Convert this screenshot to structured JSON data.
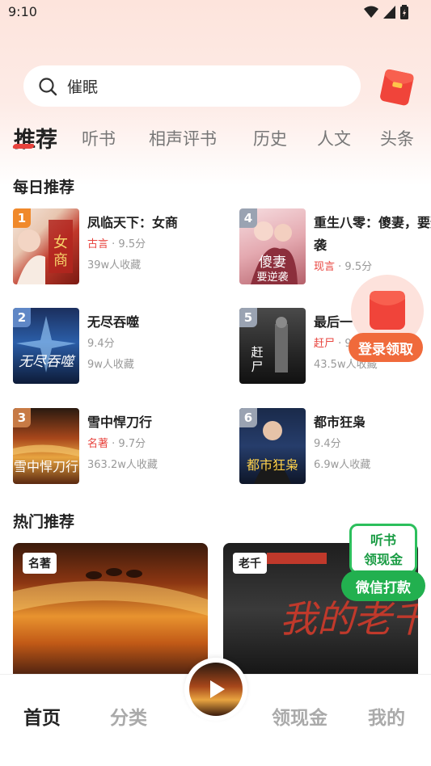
{
  "status_bar": {
    "time": "9:10"
  },
  "search": {
    "query": "催眠"
  },
  "tabs": [
    {
      "label": "推荐",
      "active": true
    },
    {
      "label": "听书"
    },
    {
      "label": "相声评书"
    },
    {
      "label": "历史"
    },
    {
      "label": "人文"
    },
    {
      "label": "头条"
    }
  ],
  "daily": {
    "title": "每日推荐",
    "books": [
      {
        "rank": "1",
        "title": "凤临天下：女商",
        "genre": "古言",
        "score": "9.5分",
        "fav": "39w人收藏"
      },
      {
        "rank": "4",
        "title": "重生八零：傻妻，要逆袭",
        "genre": "现言",
        "score": "9.5分",
        "fav": ""
      },
      {
        "rank": "2",
        "title": "无尽吞噬",
        "genre": "",
        "score": "9.4分",
        "fav": "9w人收藏"
      },
      {
        "rank": "5",
        "title": "最后一",
        "genre": "赶尸",
        "score": "9",
        "fav": "43.5w人收藏"
      },
      {
        "rank": "3",
        "title": "雪中悍刀行",
        "genre": "名著",
        "score": "9.7分",
        "fav": "363.2w人收藏"
      },
      {
        "rank": "6",
        "title": "都市狂枭",
        "genre": "",
        "score": "9.4分",
        "fav": "6.9w人收藏"
      }
    ]
  },
  "hot": {
    "title": "热门推荐",
    "cards": [
      {
        "tag": "名著"
      },
      {
        "tag": "老千"
      }
    ]
  },
  "floats": {
    "login": "登录领取",
    "listen_line1": "听书",
    "listen_line2": "领现金",
    "wechat": "微信打款"
  },
  "bottom_nav": [
    {
      "label": "首页",
      "active": true
    },
    {
      "label": "分类"
    },
    {
      "label": "领现金"
    },
    {
      "label": "我的"
    }
  ],
  "colors": {
    "accent": "#e8433d",
    "green": "#22b04f",
    "orange": "#f06a3b"
  }
}
